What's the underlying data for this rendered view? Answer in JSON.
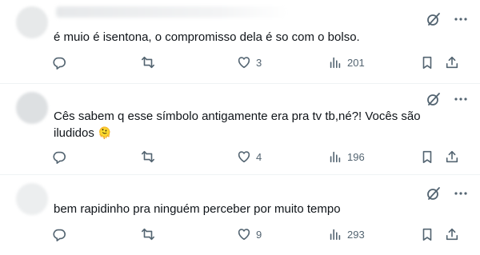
{
  "tweets": [
    {
      "text": "é muio é isentona, o compromisso dela é so com o bolso.",
      "likes": "3",
      "views": "201"
    },
    {
      "text": "Cês sabem q esse símbolo antigamente era pra tv tb,né?! Vocês são iludidos",
      "emoji": "🫠",
      "likes": "4",
      "views": "196"
    },
    {
      "text": "bem rapidinho pra ninguém perceber por muito tempo",
      "likes": "9",
      "views": "293"
    }
  ],
  "icons": [
    "grok-icon",
    "more-icon",
    "reply-icon",
    "retweet-icon",
    "like-icon",
    "views-icon",
    "bookmark-icon",
    "share-icon"
  ]
}
